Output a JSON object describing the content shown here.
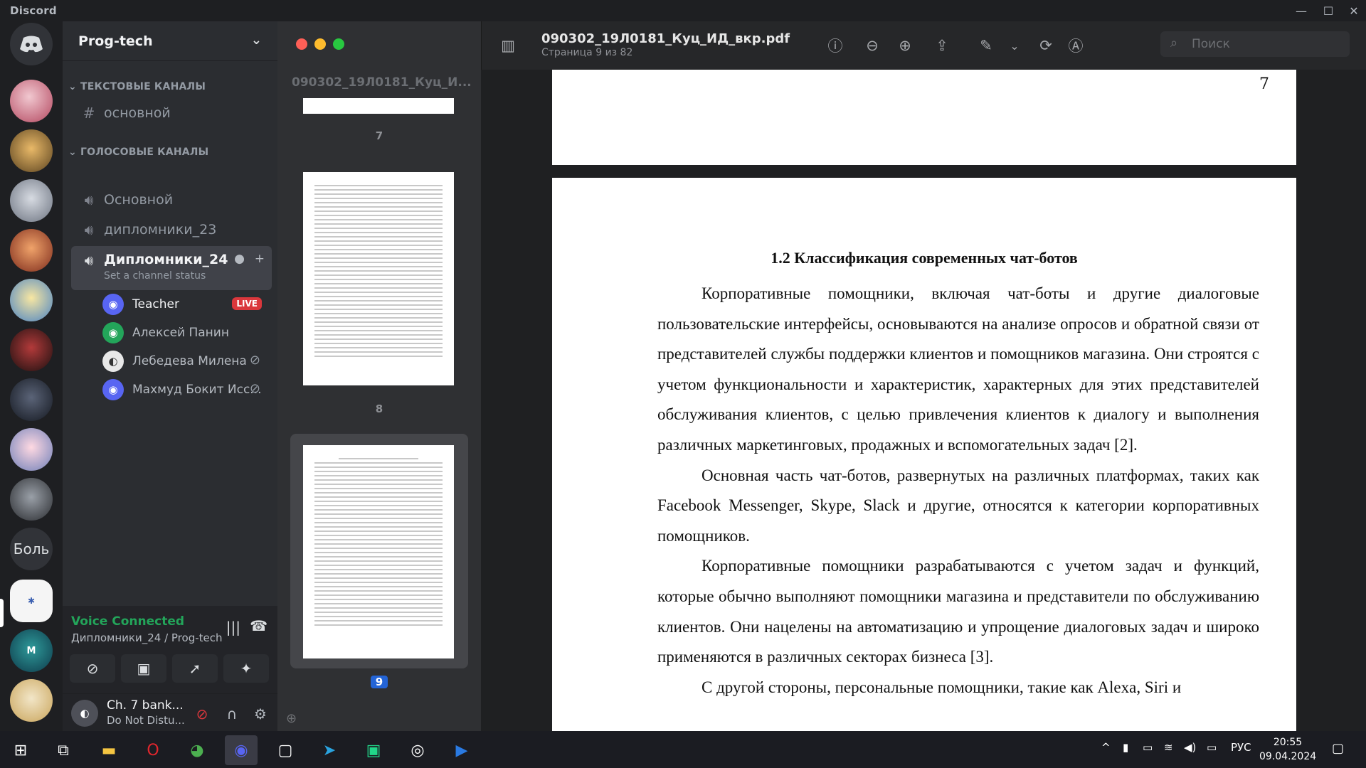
{
  "titlebar": {
    "brand": "Discord",
    "minimize": "—",
    "maximize": "☐",
    "close": "✕"
  },
  "servers": {
    "items": [
      {
        "name": "discord-home-icon",
        "glyph": "◉"
      },
      {
        "name": "server-avatar-1",
        "glyph": ""
      },
      {
        "name": "server-avatar-2",
        "glyph": ""
      },
      {
        "name": "server-avatar-3",
        "glyph": ""
      },
      {
        "name": "server-avatar-4",
        "glyph": ""
      },
      {
        "name": "server-avatar-5",
        "glyph": ""
      },
      {
        "name": "server-avatar-6",
        "glyph": ""
      },
      {
        "name": "server-avatar-7",
        "glyph": ""
      },
      {
        "name": "server-avatar-8",
        "glyph": ""
      },
      {
        "name": "server-avatar-9",
        "glyph": ""
      }
    ],
    "text_server": "Боль"
  },
  "guild": {
    "name": "Prog-tech"
  },
  "categories": {
    "text": "ТЕКСТОВЫЕ КАНАЛЫ",
    "voice": "ГОЛОСОВЫЕ КАНАЛЫ"
  },
  "text_channels": [
    {
      "label": "основной"
    }
  ],
  "voice_channels": [
    {
      "label": "Основной"
    },
    {
      "label": "дипломники_23"
    },
    {
      "label": "Дипломники_24",
      "status": "Set a channel status"
    }
  ],
  "voice_users": [
    {
      "name": "Teacher",
      "badge": "LIVE"
    },
    {
      "name": "Алексей Панин"
    },
    {
      "name": "Лебедева Милена"
    },
    {
      "name": "Махмуд Бокит Исс..."
    }
  ],
  "voice_panel": {
    "status": "Voice Connected",
    "location": "Дипломники_24 / Prog-tech"
  },
  "user_panel": {
    "name": "Ch. 7 bank...",
    "status": "Do Not Distu..."
  },
  "viewer": {
    "doc_sidebar_title": "090302_19Л0181_Куц_И...",
    "thumb_numbers": [
      "7",
      "8",
      "9"
    ],
    "filename": "090302_19Л0181_Куц_ИД_вкр.pdf",
    "page_info": "Страница 9 из 82",
    "search_placeholder": "Поиск",
    "page_top_number": "7",
    "heading": "1.2 Классификация современных чат-ботов",
    "paragraphs": [
      "Корпоративные помощники, включая чат-боты и другие диалоговые пользовательские интерфейсы, основываются на анализе опросов и обратной связи от представителей службы поддержки клиентов и помощников магазина. Они строятся с учетом функциональности и характеристик, характерных для этих представителей обслуживания клиентов, с целью привлечения клиентов к диалогу и выполнения различных маркетинговых, продажных и вспомогательных задач [2].",
      "Основная часть чат-ботов, развернутых на различных платформах, таких как Facebook Messenger, Skype, Slack и другие, относятся к категории корпоративных помощников.",
      "Корпоративные помощники разрабатываются с учетом задач и функций, которые обычно выполняют помощники магазина и представители по обслуживанию клиентов. Они нацелены на автоматизацию и упрощение диалоговых задач и широко применяются в различных секторах бизнеса [3].",
      "С другой стороны, персональные помощники, такие как Alexa, Siri и"
    ]
  },
  "taskbar": {
    "lang": "РУС",
    "time": "20:55",
    "date": "09.04.2024"
  }
}
